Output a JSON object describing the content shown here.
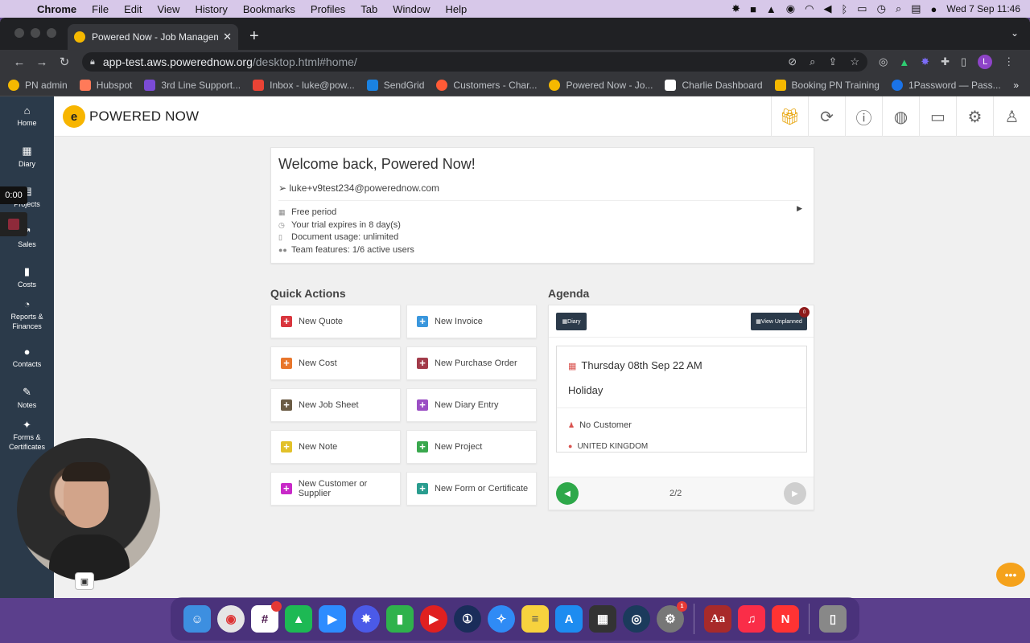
{
  "menubar": {
    "app": "Chrome",
    "items": [
      "File",
      "Edit",
      "View",
      "History",
      "Bookmarks",
      "Profiles",
      "Tab",
      "Window",
      "Help"
    ],
    "datetime": "Wed 7 Sep  11:46"
  },
  "browser": {
    "tab_title": "Powered Now - Job Manageme",
    "url_host": "app-test.aws.powerednow.org",
    "url_path": "/desktop.html#home/",
    "bookmarks": [
      {
        "label": "PN admin",
        "color": "#f5b800"
      },
      {
        "label": "Hubspot",
        "color": "#ff7a59"
      },
      {
        "label": "3rd Line Support...",
        "color": "#7b4bd6"
      },
      {
        "label": "Inbox - luke@pow...",
        "color": "#ea4335"
      },
      {
        "label": "SendGrid",
        "color": "#1a82e2"
      },
      {
        "label": "Customers - Char...",
        "color": "#ff5a36"
      },
      {
        "label": "Powered Now - Jo...",
        "color": "#f5b800"
      },
      {
        "label": "Charlie Dashboard",
        "color": "#ffffff"
      },
      {
        "label": "Booking PN Training",
        "color": "#f5b800"
      },
      {
        "label": "1Password — Pass...",
        "color": "#1a73e8"
      }
    ],
    "profile_initial": "L"
  },
  "sidebar": {
    "items": [
      {
        "label": "Home",
        "icon": "home-icon",
        "glyph": "⌂"
      },
      {
        "label": "Diary",
        "icon": "calendar-icon",
        "glyph": "▦"
      },
      {
        "label": "Projects",
        "icon": "clipboard-icon",
        "glyph": "▤"
      },
      {
        "label": "Sales",
        "icon": "sales-icon",
        "glyph": "↗"
      },
      {
        "label": "Costs",
        "icon": "bar-chart-icon",
        "glyph": "▮"
      },
      {
        "label": "Reports & Finances",
        "icon": "pie-chart-icon",
        "glyph": "◔"
      },
      {
        "label": "Contacts",
        "icon": "users-icon",
        "glyph": "●"
      },
      {
        "label": "Notes",
        "icon": "note-icon",
        "glyph": "✎"
      },
      {
        "label": "Forms & Certificates",
        "icon": "certificate-icon",
        "glyph": "✦"
      }
    ]
  },
  "header": {
    "logo_text": "POWERED NOW",
    "icons": [
      "gift-icon",
      "refresh-icon",
      "help-icon",
      "globe-icon",
      "chat-icon",
      "gear-icon",
      "user-icon"
    ]
  },
  "welcome": {
    "title": "Welcome back, Powered Now!",
    "email": "luke+v9test234@powerednow.com",
    "lines": [
      "Free period",
      "Your trial expires in 8 day(s)",
      "Document usage: unlimited",
      "Team features: 1/6 active users"
    ]
  },
  "quick_actions": {
    "title": "Quick Actions",
    "items": [
      {
        "label": "New Quote",
        "color": "#d9363e"
      },
      {
        "label": "New Invoice",
        "color": "#3a97dd"
      },
      {
        "label": "New Cost",
        "color": "#e8762c"
      },
      {
        "label": "New Purchase Order",
        "color": "#a23b4a"
      },
      {
        "label": "New Job Sheet",
        "color": "#6b5c45"
      },
      {
        "label": "New Diary Entry",
        "color": "#9b4fc4"
      },
      {
        "label": "New Note",
        "color": "#e2c12a"
      },
      {
        "label": "New Project",
        "color": "#3aa84e"
      },
      {
        "label": "New Customer or Supplier",
        "color": "#c829c8"
      },
      {
        "label": "New Form or Certificate",
        "color": "#2a9d8f"
      }
    ]
  },
  "agenda": {
    "title": "Agenda",
    "diary_button": "Diary",
    "unplanned_button": "View Unplanned",
    "unplanned_count": "0",
    "event": {
      "date": "Thursday 08th Sep 22 AM",
      "type": "Holiday",
      "customer": "No Customer",
      "location": "UNITED KINGDOM"
    },
    "pager": "2/2"
  },
  "recorder": {
    "timer": "0:00"
  },
  "dock_badges": {
    "slack": "",
    "settings": "1"
  }
}
